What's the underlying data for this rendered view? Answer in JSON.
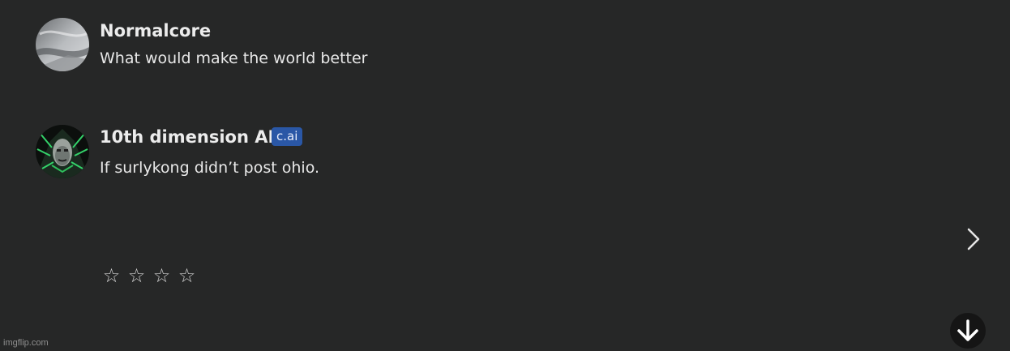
{
  "messages": [
    {
      "author": "Normalcore",
      "text": "What would make the world better",
      "avatar_icon": "user-avatar-icon"
    },
    {
      "author": "10th dimension AI",
      "badge": "c.ai",
      "text": "If surlykong didn’t post ohio.",
      "avatar_icon": "ai-character-avatar-icon"
    }
  ],
  "rating": {
    "stars": [
      "☆",
      "☆",
      "☆",
      "☆"
    ],
    "value": 0,
    "max": 4
  },
  "controls": {
    "next_icon": "chevron-right-icon",
    "scroll_icon": "arrow-down-icon"
  },
  "watermark": "imgflip.com",
  "colors": {
    "background": "#262727",
    "badge": "#2a57a6",
    "text": "#e8e8e8"
  }
}
